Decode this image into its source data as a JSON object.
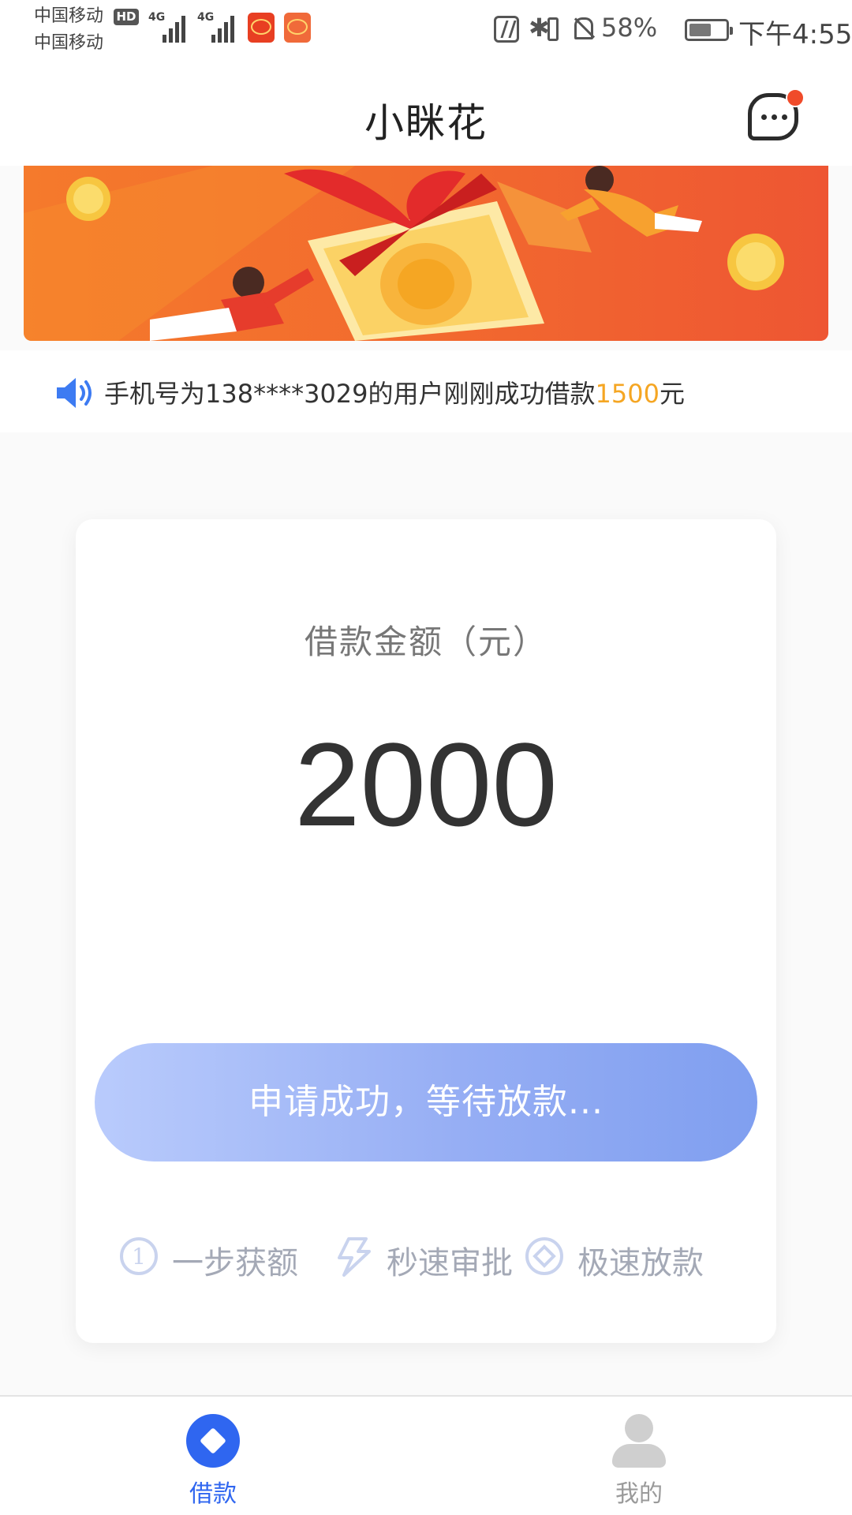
{
  "status_bar": {
    "carrier_1": "中国移动",
    "carrier_2": "中国移动",
    "hd_label": "HD",
    "network_1": "4G",
    "network_2": "4G",
    "battery_percent": "58%",
    "time": "下午4:55",
    "icons": [
      "signal-icon",
      "nfc-icon",
      "bluetooth-icon",
      "mute-icon",
      "battery-icon"
    ]
  },
  "header": {
    "title": "小眯花",
    "message_icon": "chat-bubble-icon",
    "has_unread_dot": true
  },
  "notice": {
    "icon": "speaker-icon",
    "text_before": "手机号为138****3029的用户刚刚成功借款",
    "amount": "1500",
    "text_after": "元"
  },
  "card": {
    "amount_label": "借款金额（元）",
    "amount_value": "2000",
    "status_button": "申请成功，等待放款...",
    "features": [
      {
        "icon": "step-one-icon",
        "label": "一步获额"
      },
      {
        "icon": "lightning-icon",
        "label": "秒速审批"
      },
      {
        "icon": "diamond-circle-icon",
        "label": "极速放款"
      }
    ]
  },
  "bottom_nav": {
    "items": [
      {
        "label": "借款",
        "icon": "loan-icon",
        "active": true
      },
      {
        "label": "我的",
        "icon": "person-icon",
        "active": false
      }
    ]
  },
  "colors": {
    "accent_blue": "#2f66f0",
    "highlight_orange": "#f5a623",
    "button_gradient_start": "#b9cbfc",
    "button_gradient_end": "#809ff0",
    "banner_orange": "#f26a2e",
    "notification_red": "#f04b2a"
  }
}
